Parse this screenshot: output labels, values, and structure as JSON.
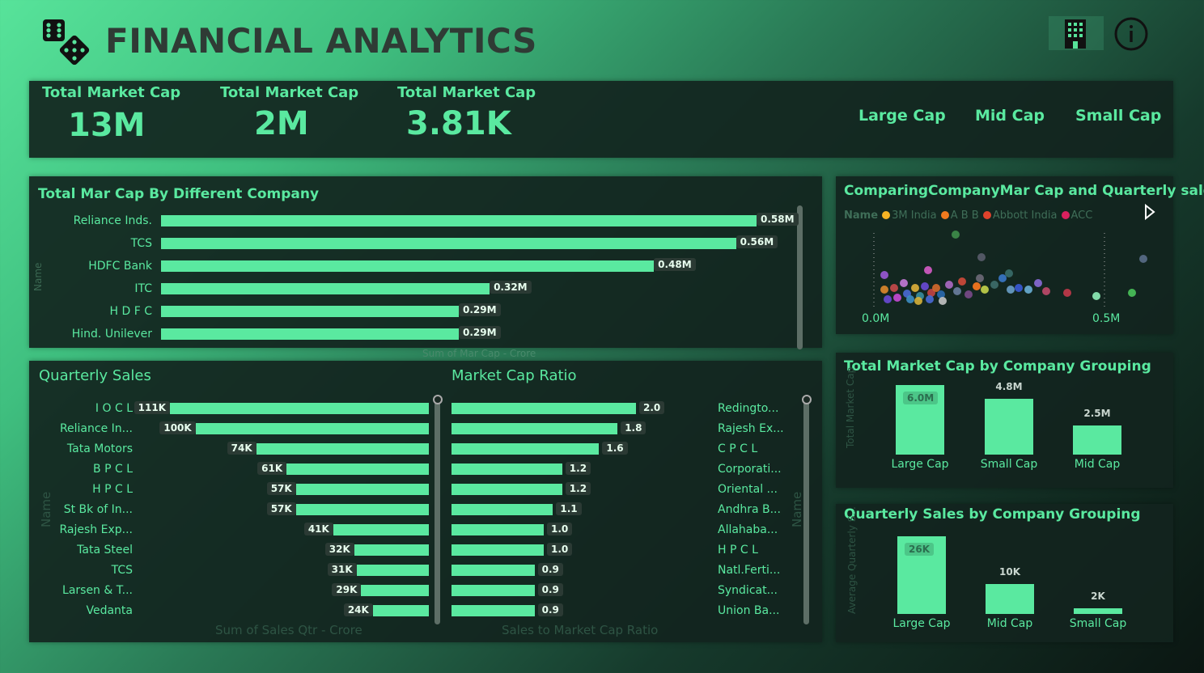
{
  "header": {
    "title": "FINANCIAL ANALYTICS"
  },
  "kpis": [
    {
      "label": "Total Market Cap",
      "value": "13M"
    },
    {
      "label": "Total Market Cap",
      "value": "2M"
    },
    {
      "label": "Total Market Cap",
      "value": "3.81K"
    }
  ],
  "cap_buttons": [
    "Large Cap",
    "Mid Cap",
    "Small Cap"
  ],
  "mar_cap_chart": {
    "title": "Total Mar Cap By Different Company",
    "ylabel": "Name",
    "xlabel": "Sum of Mar Cap - Crore",
    "rows": [
      {
        "name": "Reliance Inds.",
        "value": 0.58,
        "label": "0.58M"
      },
      {
        "name": "TCS",
        "value": 0.56,
        "label": "0.56M"
      },
      {
        "name": "HDFC Bank",
        "value": 0.48,
        "label": "0.48M"
      },
      {
        "name": "ITC",
        "value": 0.32,
        "label": "0.32M"
      },
      {
        "name": "H D F C",
        "value": 0.29,
        "label": "0.29M"
      },
      {
        "name": "Hind. Unilever",
        "value": 0.29,
        "label": "0.29M"
      }
    ]
  },
  "scatter": {
    "title": "ComparingCompanyMar Cap and Quarterly sales",
    "legend_title": "Name",
    "legend": [
      {
        "name": "3M India",
        "color": "#f5b324"
      },
      {
        "name": "A B B",
        "color": "#f07a1e"
      },
      {
        "name": "Abbott India",
        "color": "#e0432c"
      },
      {
        "name": "ACC",
        "color": "#d9205e"
      }
    ],
    "x_ticks": [
      "0.0M",
      "0.5M"
    ]
  },
  "quarterly_sales": {
    "title": "Quarterly Sales",
    "ylabel": "Name",
    "xlabel": "Sum of Sales Qtr - Crore",
    "rows": [
      {
        "name": "I O C L",
        "value": 111,
        "label": "111K"
      },
      {
        "name": "Reliance In...",
        "value": 100,
        "label": "100K"
      },
      {
        "name": "Tata Motors",
        "value": 74,
        "label": "74K"
      },
      {
        "name": "B P C L",
        "value": 61,
        "label": "61K"
      },
      {
        "name": "H P C L",
        "value": 57,
        "label": "57K"
      },
      {
        "name": "St Bk of In...",
        "value": 57,
        "label": "57K"
      },
      {
        "name": "Rajesh Exp...",
        "value": 41,
        "label": "41K"
      },
      {
        "name": "Tata Steel",
        "value": 32,
        "label": "32K"
      },
      {
        "name": "TCS",
        "value": 31,
        "label": "31K"
      },
      {
        "name": "Larsen & T...",
        "value": 29,
        "label": "29K"
      },
      {
        "name": "Vedanta",
        "value": 24,
        "label": "24K"
      }
    ]
  },
  "market_cap_ratio": {
    "title": "Market Cap Ratio",
    "ylabel": "Name",
    "xlabel": "Sales to Market Cap Ratio",
    "rows": [
      {
        "name": "Redingto...",
        "value": 2.0,
        "label": "2.0"
      },
      {
        "name": "Rajesh Ex...",
        "value": 1.8,
        "label": "1.8"
      },
      {
        "name": "C P C L",
        "value": 1.6,
        "label": "1.6"
      },
      {
        "name": "Corporati...",
        "value": 1.2,
        "label": "1.2"
      },
      {
        "name": "Oriental ...",
        "value": 1.2,
        "label": "1.2"
      },
      {
        "name": "Andhra B...",
        "value": 1.1,
        "label": "1.1"
      },
      {
        "name": "Allahaba...",
        "value": 1.0,
        "label": "1.0"
      },
      {
        "name": "H P C L",
        "value": 1.0,
        "label": "1.0"
      },
      {
        "name": "Natl.Ferti...",
        "value": 0.9,
        "label": "0.9"
      },
      {
        "name": "Syndicat...",
        "value": 0.9,
        "label": "0.9"
      },
      {
        "name": "Union Ba...",
        "value": 0.9,
        "label": "0.9"
      }
    ]
  },
  "grouping_mcap": {
    "title": "Total Market Cap by Company Grouping",
    "ylabel": "Total Market Cap",
    "bars": [
      {
        "name": "Large Cap",
        "value": 6.0,
        "label": "6.0M"
      },
      {
        "name": "Small Cap",
        "value": 4.8,
        "label": "4.8M"
      },
      {
        "name": "Mid Cap",
        "value": 2.5,
        "label": "2.5M"
      }
    ]
  },
  "grouping_sales": {
    "title": "Quarterly Sales by Company Grouping",
    "ylabel": "Average Quarterly S...",
    "bars": [
      {
        "name": "Large Cap",
        "value": 26,
        "label": "26K"
      },
      {
        "name": "Mid Cap",
        "value": 10,
        "label": "10K"
      },
      {
        "name": "Small Cap",
        "value": 2,
        "label": "2K"
      }
    ]
  },
  "chart_data": [
    {
      "type": "bar",
      "title": "Total Mar Cap By Different Company",
      "categories": [
        "Reliance Inds.",
        "TCS",
        "HDFC Bank",
        "ITC",
        "H D F C",
        "Hind. Unilever"
      ],
      "values": [
        0.58,
        0.56,
        0.48,
        0.32,
        0.29,
        0.29
      ],
      "xlabel": "Sum of Mar Cap - Crore",
      "ylabel": "Name"
    },
    {
      "type": "bar",
      "title": "Quarterly Sales",
      "categories": [
        "I O C L",
        "Reliance In...",
        "Tata Motors",
        "B P C L",
        "H P C L",
        "St Bk of In...",
        "Rajesh Exp...",
        "Tata Steel",
        "TCS",
        "Larsen & T...",
        "Vedanta"
      ],
      "values": [
        111,
        100,
        74,
        61,
        57,
        57,
        41,
        32,
        31,
        29,
        24
      ],
      "xlabel": "Sum of Sales Qtr - Crore",
      "ylabel": "Name"
    },
    {
      "type": "bar",
      "title": "Market Cap Ratio",
      "categories": [
        "Redingto...",
        "Rajesh Ex...",
        "C P C L",
        "Corporati...",
        "Oriental ...",
        "Andhra B...",
        "Allahaba...",
        "H P C L",
        "Natl.Ferti...",
        "Syndicat...",
        "Union Ba..."
      ],
      "values": [
        2.0,
        1.8,
        1.6,
        1.2,
        1.2,
        1.1,
        1.0,
        1.0,
        0.9,
        0.9,
        0.9
      ],
      "xlabel": "Sales to Market Cap Ratio",
      "ylabel": "Name"
    },
    {
      "type": "bar",
      "title": "Total Market Cap by Company Grouping",
      "categories": [
        "Large Cap",
        "Small Cap",
        "Mid Cap"
      ],
      "values": [
        6.0,
        4.8,
        2.5
      ]
    },
    {
      "type": "bar",
      "title": "Quarterly Sales by Company Grouping",
      "categories": [
        "Large Cap",
        "Mid Cap",
        "Small Cap"
      ],
      "values": [
        26,
        10,
        2
      ]
    },
    {
      "type": "scatter",
      "title": "ComparingCompanyMar Cap and Quarterly sales",
      "x_ticks": [
        "0.0M",
        "0.5M"
      ],
      "legend": [
        "3M India",
        "A B B",
        "Abbott India",
        "ACC"
      ]
    }
  ]
}
